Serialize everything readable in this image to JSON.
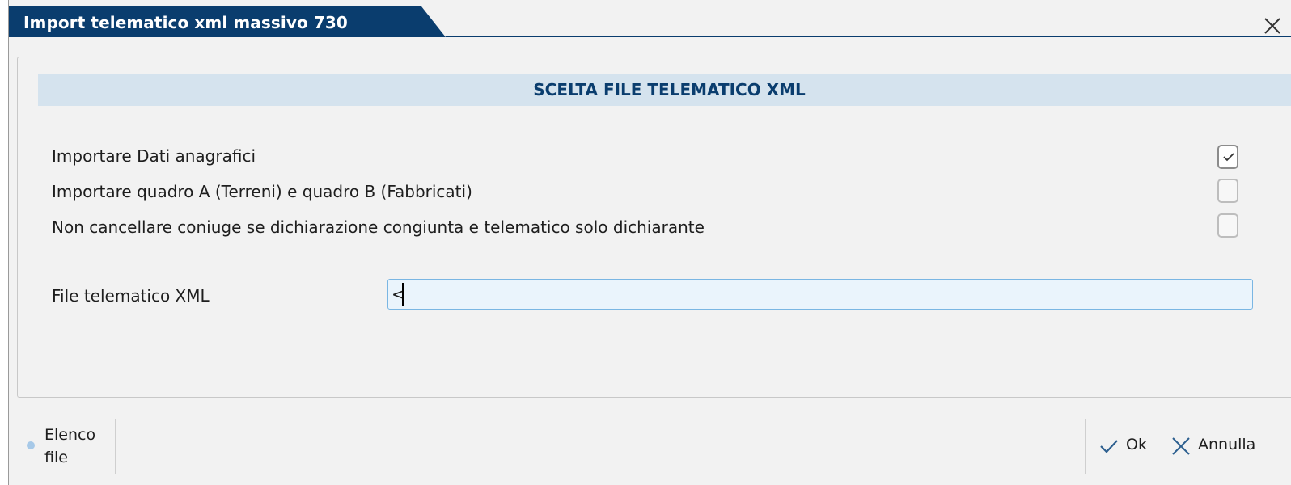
{
  "window": {
    "title": "Import telematico xml massivo 730",
    "close_icon": "close-icon"
  },
  "section": {
    "header": "SCELTA FILE TELEMATICO XML"
  },
  "options": [
    {
      "label": "Importare Dati anagrafici",
      "checked": true
    },
    {
      "label": "Importare quadro A (Terreni) e quadro B (Fabbricati)",
      "checked": false
    },
    {
      "label": "Non cancellare coniuge se dichiarazione congiunta e telematico solo dichiarante",
      "checked": false
    }
  ],
  "file_field": {
    "label": "File telematico XML",
    "value": "<"
  },
  "footer": {
    "elenco_label": "Elenco file",
    "ok_label": "Ok",
    "annulla_label": "Annulla"
  },
  "colors": {
    "title_bar": "#0a3d6e",
    "section_header_bg": "#d5e3ee",
    "input_bg": "#eaf4fc",
    "input_border": "#7ab6e3"
  }
}
